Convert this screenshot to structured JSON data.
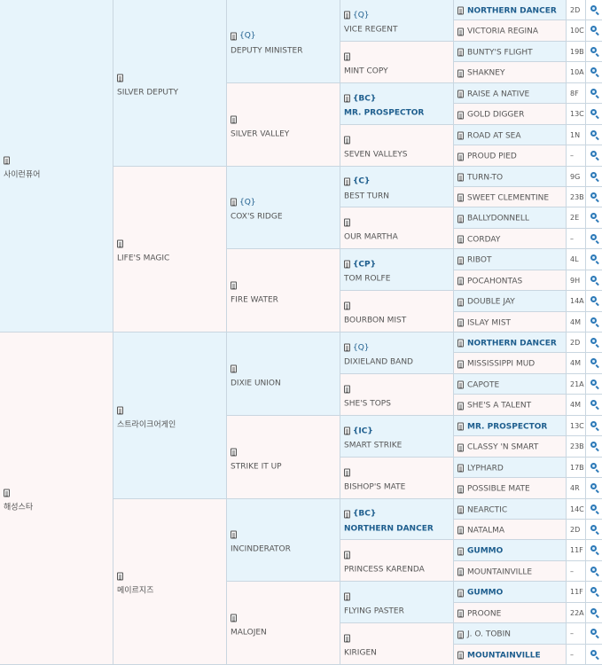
{
  "gen1": [
    {
      "name": "사이런퓨어",
      "tag": ""
    },
    {
      "name": "해성스타",
      "tag": ""
    }
  ],
  "gen2": [
    {
      "name": "SILVER DEPUTY",
      "tag": ""
    },
    {
      "name": "LIFE'S MAGIC",
      "tag": ""
    },
    {
      "name": "스트라이크어게인",
      "tag": ""
    },
    {
      "name": "메이르지즈",
      "tag": ""
    }
  ],
  "gen3": [
    {
      "name": "DEPUTY MINISTER",
      "tag": "{Q}"
    },
    {
      "name": "SILVER VALLEY",
      "tag": ""
    },
    {
      "name": "COX'S RIDGE",
      "tag": "{Q}"
    },
    {
      "name": "FIRE WATER",
      "tag": ""
    },
    {
      "name": "DIXIE UNION",
      "tag": ""
    },
    {
      "name": "STRIKE IT UP",
      "tag": ""
    },
    {
      "name": "INCINDERATOR",
      "tag": ""
    },
    {
      "name": "MALOJEN",
      "tag": ""
    }
  ],
  "gen4": [
    {
      "name": "VICE REGENT",
      "tag": "{Q}"
    },
    {
      "name": "MINT COPY",
      "tag": ""
    },
    {
      "name": "MR. PROSPECTOR",
      "tag": "{BC}",
      "link": true
    },
    {
      "name": "SEVEN VALLEYS",
      "tag": ""
    },
    {
      "name": "BEST TURN",
      "tag": "{C}"
    },
    {
      "name": "OUR MARTHA",
      "tag": ""
    },
    {
      "name": "TOM ROLFE",
      "tag": "{CP}"
    },
    {
      "name": "BOURBON MIST",
      "tag": ""
    },
    {
      "name": "DIXIELAND BAND",
      "tag": "{Q}"
    },
    {
      "name": "SHE'S TOPS",
      "tag": ""
    },
    {
      "name": "SMART STRIKE",
      "tag": "{IC}"
    },
    {
      "name": "BISHOP'S MATE",
      "tag": ""
    },
    {
      "name": "NORTHERN DANCER",
      "tag": "{BC}",
      "link": true
    },
    {
      "name": "PRINCESS KARENDA",
      "tag": ""
    },
    {
      "name": "FLYING PASTER",
      "tag": ""
    },
    {
      "name": "KIRIGEN",
      "tag": ""
    }
  ],
  "gen5": [
    {
      "name": "NORTHERN DANCER",
      "code": "2D",
      "link": true
    },
    {
      "name": "VICTORIA REGINA",
      "code": "10C"
    },
    {
      "name": "BUNTY'S FLIGHT",
      "code": "19B"
    },
    {
      "name": "SHAKNEY",
      "code": "10A"
    },
    {
      "name": "RAISE A NATIVE",
      "code": "8F"
    },
    {
      "name": "GOLD DIGGER",
      "code": "13C"
    },
    {
      "name": "ROAD AT SEA",
      "code": "1N"
    },
    {
      "name": "PROUD PIED",
      "code": "–"
    },
    {
      "name": "TURN-TO",
      "code": "9G"
    },
    {
      "name": "SWEET CLEMENTINE",
      "code": "23B"
    },
    {
      "name": "BALLYDONNELL",
      "code": "2E"
    },
    {
      "name": "CORDAY",
      "code": "–"
    },
    {
      "name": "RIBOT",
      "code": "4L"
    },
    {
      "name": "POCAHONTAS",
      "code": "9H"
    },
    {
      "name": "DOUBLE JAY",
      "code": "14A"
    },
    {
      "name": "ISLAY MIST",
      "code": "4M"
    },
    {
      "name": "NORTHERN DANCER",
      "code": "2D",
      "link": true
    },
    {
      "name": "MISSISSIPPI MUD",
      "code": "4M"
    },
    {
      "name": "CAPOTE",
      "code": "21A"
    },
    {
      "name": "SHE'S A TALENT",
      "code": "4M"
    },
    {
      "name": "MR. PROSPECTOR",
      "code": "13C",
      "link": true
    },
    {
      "name": "CLASSY 'N SMART",
      "code": "23B"
    },
    {
      "name": "LYPHARD",
      "code": "17B"
    },
    {
      "name": "POSSIBLE MATE",
      "code": "4R"
    },
    {
      "name": "NEARCTIC",
      "code": "14C"
    },
    {
      "name": "NATALMA",
      "code": "2D"
    },
    {
      "name": "GUMMO",
      "code": "11F",
      "link": true
    },
    {
      "name": "MOUNTAINVILLE",
      "code": "–"
    },
    {
      "name": "GUMMO",
      "code": "11F",
      "link": true
    },
    {
      "name": "PROONE",
      "code": "22A"
    },
    {
      "name": "J. O. TOBIN",
      "code": "–"
    },
    {
      "name": "MOUNTAINVILLE",
      "code": "–",
      "link": true
    }
  ],
  "icons": {
    "record": "document-icon",
    "search": "magnifier-icon"
  },
  "colors": {
    "male_bg": "#e7f4fb",
    "female_bg": "#fdf6f6",
    "link": "#1e5e8e"
  }
}
